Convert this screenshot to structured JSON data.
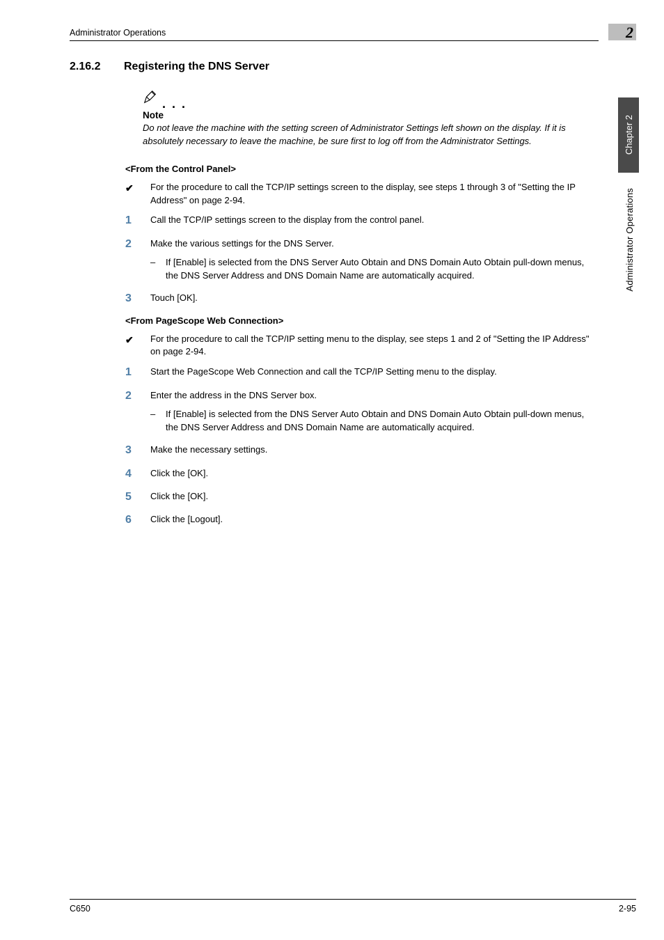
{
  "header": {
    "running": "Administrator Operations",
    "corner_num": "2"
  },
  "section": {
    "num": "2.16.2",
    "title": "Registering the DNS Server"
  },
  "note": {
    "label": "Note",
    "text": "Do not leave the machine with the setting screen of Administrator Settings left shown on the display. If it is absolutely necessary to leave the machine, be sure first to log off from the Administrator Settings."
  },
  "panel1": {
    "heading": "<From the Control Panel>",
    "pre": "For the procedure to call the TCP/IP settings screen to the display, see steps 1 through 3 of \"Setting the IP Address\" on page 2-94.",
    "steps": [
      {
        "n": "1",
        "t": "Call the TCP/IP settings screen to the display from the control panel."
      },
      {
        "n": "2",
        "t": "Make the various settings for the DNS Server.",
        "sub": "If [Enable] is selected from the DNS Server Auto Obtain and DNS Domain Auto Obtain pull-down menus, the DNS Server Address and DNS Domain Name are automatically acquired."
      },
      {
        "n": "3",
        "t": "Touch [OK]."
      }
    ]
  },
  "panel2": {
    "heading": "<From PageScope Web Connection>",
    "pre": "For the procedure to call the TCP/IP setting menu to the display, see steps 1 and 2 of \"Setting the IP Address\" on page 2-94.",
    "steps": [
      {
        "n": "1",
        "t": "Start the PageScope Web Connection and call the TCP/IP Setting menu to the display."
      },
      {
        "n": "2",
        "t": "Enter the address in the DNS Server box.",
        "sub": "If [Enable] is selected from the DNS Server Auto Obtain and DNS Domain Auto Obtain pull-down menus, the DNS Server Address and DNS Domain Name are automatically acquired."
      },
      {
        "n": "3",
        "t": "Make the necessary settings."
      },
      {
        "n": "4",
        "t": "Click the [OK]."
      },
      {
        "n": "5",
        "t": "Click the [OK]."
      },
      {
        "n": "6",
        "t": "Click the [Logout]."
      }
    ]
  },
  "sidebar": {
    "chapter": "Chapter 2",
    "ops": "Administrator Operations"
  },
  "footer": {
    "left": "C650",
    "right": "2-95"
  },
  "glyphs": {
    "check": "✔",
    "dash": "–"
  }
}
